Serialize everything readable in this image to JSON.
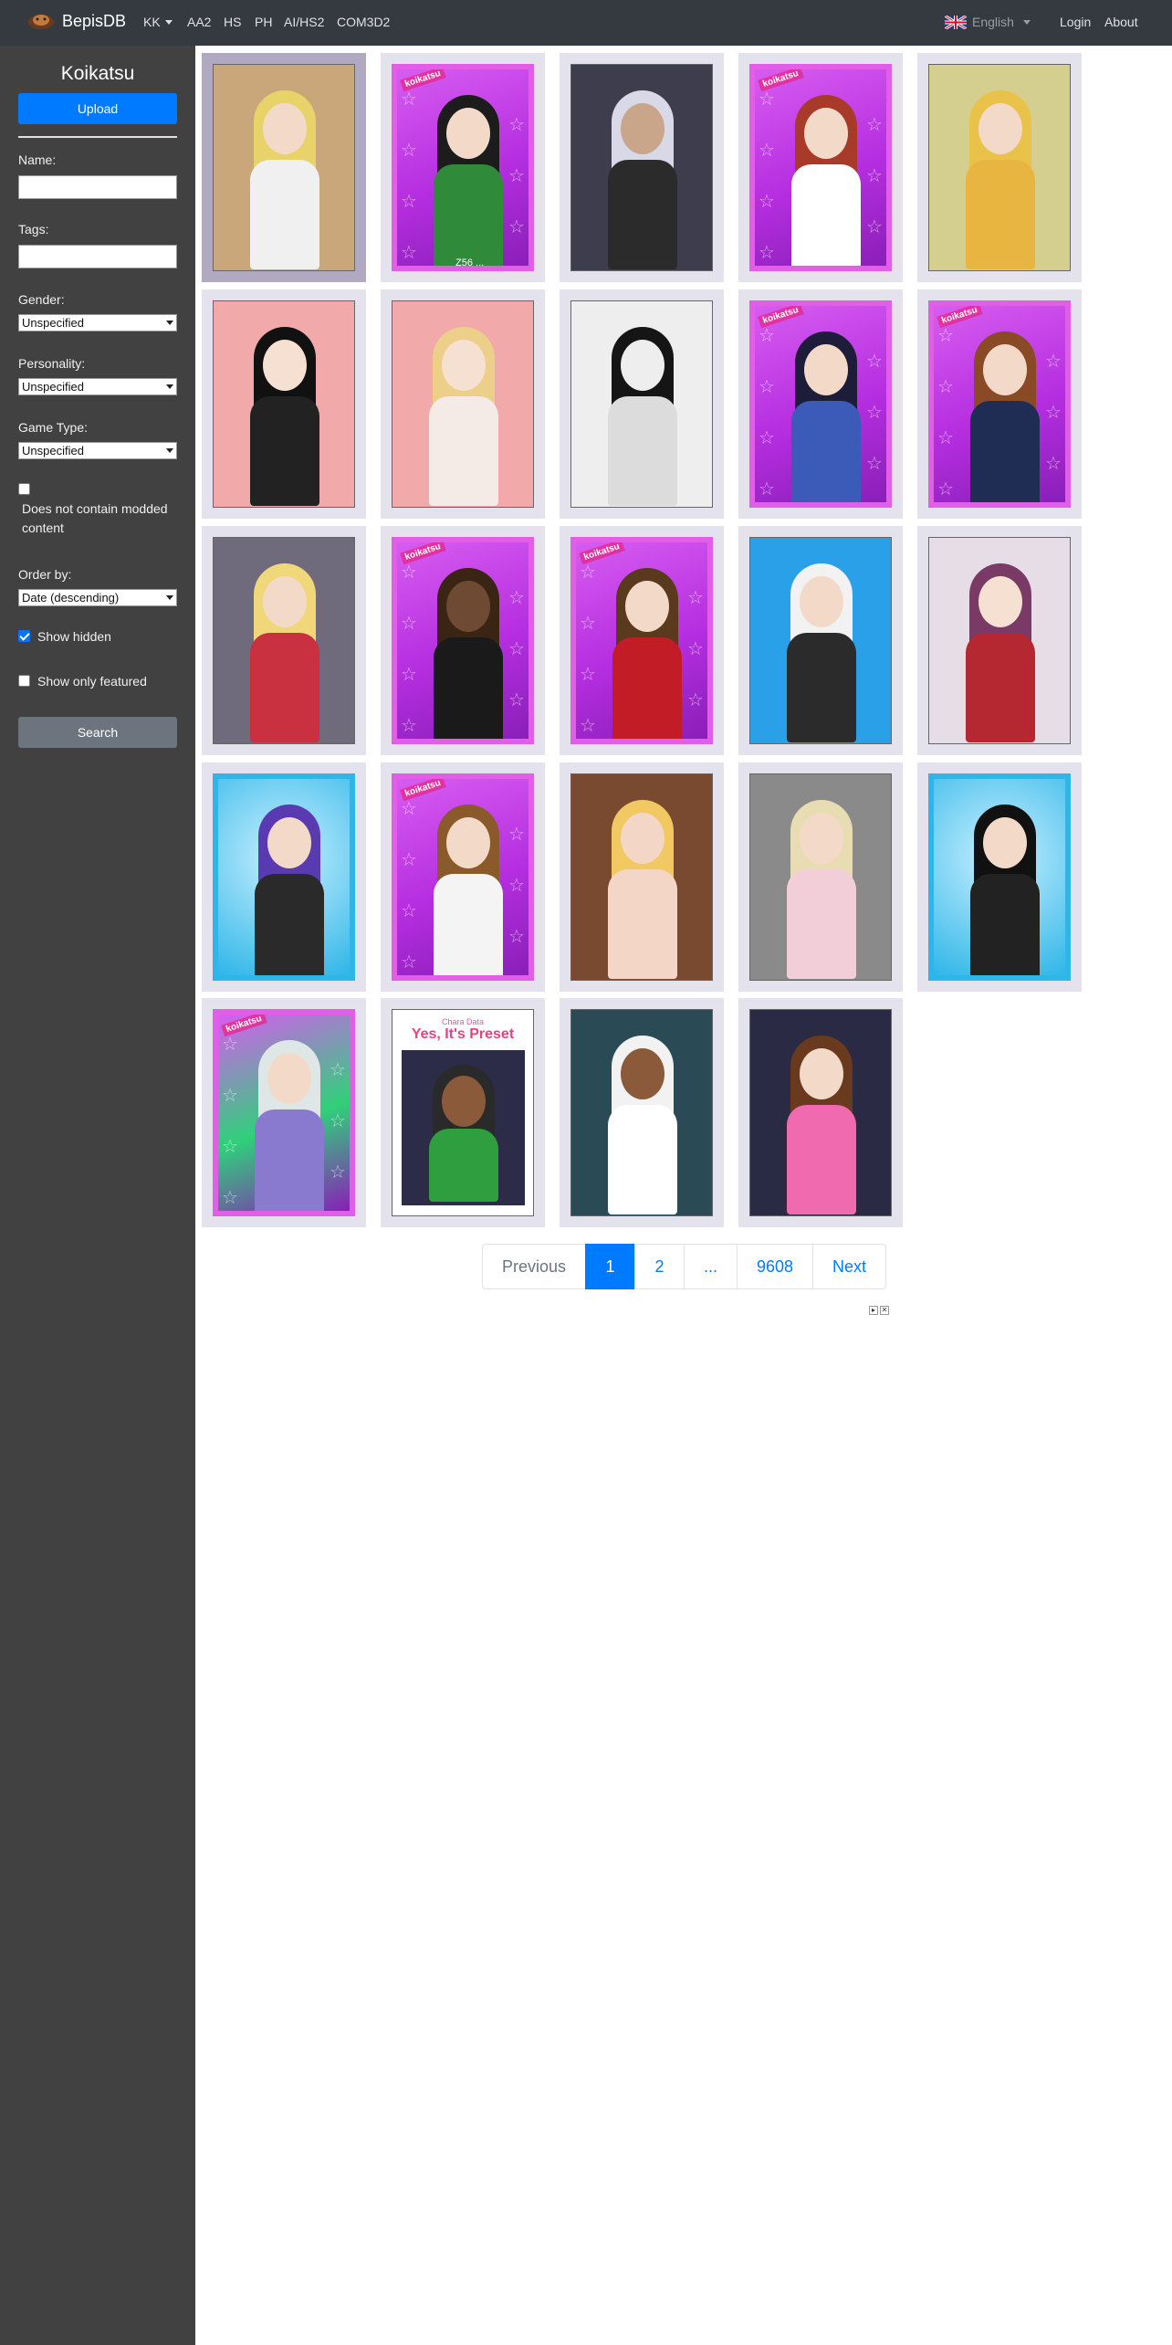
{
  "navbar": {
    "brand": "BepisDB",
    "games": [
      "KK",
      "AA2",
      "HS",
      "PH",
      "AI/HS2",
      "COM3D2"
    ],
    "language": "English",
    "login": "Login",
    "about": "About"
  },
  "sidebar": {
    "title": "Koikatsu",
    "upload_label": "Upload",
    "name_label": "Name:",
    "name_value": "",
    "tags_label": "Tags:",
    "tags_value": "",
    "gender_label": "Gender:",
    "gender_value": "Unspecified",
    "personality_label": "Personality:",
    "personality_value": "Unspecified",
    "gametype_label": "Game Type:",
    "gametype_value": "Unspecified",
    "modded_label": "Does not contain modded content",
    "modded_checked": false,
    "orderby_label": "Order by:",
    "orderby_value": "Date (descending)",
    "show_hidden_label": "Show hidden",
    "show_hidden_checked": true,
    "show_featured_label": "Show only featured",
    "show_featured_checked": false,
    "search_label": "Search"
  },
  "cards": [
    {
      "bg": "#c9a77a",
      "frame": "plain",
      "hair": "#e8d36a",
      "body": "#f0f0f0",
      "skin": "#f3dac8"
    },
    {
      "bg": "#b52ee0",
      "frame": "koikatsu",
      "hair": "#1c1c1c",
      "body": "#2f8a3a",
      "skin": "#f3dac8",
      "caption": "Z56 ..."
    },
    {
      "bg": "#3d3d4e",
      "frame": "plain",
      "hair": "#d8d8e6",
      "body": "#2b2b2b",
      "skin": "#c9a58a"
    },
    {
      "bg": "#b52ee0",
      "frame": "koikatsu",
      "hair": "#a83a2a",
      "body": "#ffffff",
      "skin": "#f3dac8"
    },
    {
      "bg": "#d4cf8f",
      "frame": "plain",
      "hair": "#e9c24a",
      "body": "#e8b640",
      "skin": "#f3dac8"
    },
    {
      "bg": "#f2a9aa",
      "frame": "plain",
      "hair": "#111111",
      "body": "#222222",
      "skin": "#f6e0d2"
    },
    {
      "bg": "#f2a9aa",
      "frame": "plain",
      "hair": "#ecd08a",
      "body": "#f4eae6",
      "skin": "#f6e0d2"
    },
    {
      "bg": "#eeeeee",
      "frame": "plain",
      "hair": "#151515",
      "body": "#dcdcdc",
      "skin": "#eeeeee"
    },
    {
      "bg": "#b52ee0",
      "frame": "koikatsu",
      "hair": "#1d1d3a",
      "body": "#3c5ab8",
      "skin": "#f3dac8"
    },
    {
      "bg": "#b52ee0",
      "frame": "koikatsu",
      "hair": "#8a4a25",
      "body": "#1f2d55",
      "skin": "#f3dac8"
    },
    {
      "bg": "#6f6a7c",
      "frame": "plain",
      "hair": "#f0d87a",
      "body": "#c93040",
      "skin": "#f3dac8"
    },
    {
      "bg": "#b52ee0",
      "frame": "koikatsu",
      "hair": "#3a2413",
      "body": "#1a1a1a",
      "skin": "#6e4a32"
    },
    {
      "bg": "#b52ee0",
      "frame": "koikatsu",
      "hair": "#5a3a1c",
      "body": "#c21d26",
      "skin": "#f3dac8"
    },
    {
      "bg": "#2aa0e8",
      "frame": "plain",
      "hair": "#f2f2f2",
      "body": "#2b2b2b",
      "skin": "#f3dac8"
    },
    {
      "bg": "#e6dde6",
      "frame": "plain",
      "hair": "#7a3a66",
      "body": "#b52832",
      "skin": "#f6e0d2"
    },
    {
      "bg": "#2fb6e8",
      "frame": "sunshine",
      "hair": "#5a3ab0",
      "body": "#2a2a2a",
      "skin": "#f3dac8"
    },
    {
      "bg": "#b52ee0",
      "frame": "koikatsu",
      "hair": "#8a5a2a",
      "body": "#f4f4f4",
      "skin": "#f3dac8"
    },
    {
      "bg": "#7a4a30",
      "frame": "plain",
      "hair": "#f2c862",
      "body": "#f3d6c6",
      "skin": "#f3d6c6"
    },
    {
      "bg": "#8a8a8a",
      "frame": "plain",
      "hair": "#e8dcb2",
      "body": "#f2cfd8",
      "skin": "#f3dac8"
    },
    {
      "bg": "#2fb6e8",
      "frame": "sunshine",
      "hair": "#111111",
      "body": "#222222",
      "skin": "#f3dac8"
    },
    {
      "bg": "#2fd07a",
      "frame": "koikatsu",
      "hair": "#dfe6e6",
      "body": "#8a7acf",
      "skin": "#f3dac8"
    },
    {
      "bg": "#ffffff",
      "frame": "preset",
      "hair": "#2a2a2a",
      "body": "#2f9e3e",
      "skin": "#8a5a3a",
      "preset_small": "Chara Data",
      "preset_title": "Yes, It's Preset"
    },
    {
      "bg": "#2a4a55",
      "frame": "plain",
      "hair": "#f2f2f2",
      "body": "#ffffff",
      "skin": "#8a5a3a"
    },
    {
      "bg": "#2a2a44",
      "frame": "plain",
      "hair": "#6a3a1e",
      "body": "#f06ab0",
      "skin": "#f3dac8"
    }
  ],
  "pagination": {
    "previous": "Previous",
    "pages": [
      "1",
      "2",
      "...",
      "9608"
    ],
    "next": "Next",
    "active_page": "1"
  }
}
